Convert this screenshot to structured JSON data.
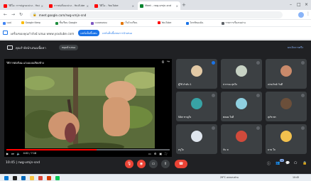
{
  "browser": {
    "tabs": [
      {
        "title": "วิดีโอ: การปลูกมะม่วง - YouTube",
        "favicon_color": "#ff0000"
      },
      {
        "title": "การต่อกิ่งมะม่วง - YouTube",
        "favicon_color": "#ff0000"
      },
      {
        "title": "วิดีโอ - YouTube",
        "favicon_color": "#ff0000"
      },
      {
        "title": "Meet - rwg-vmjn-snd",
        "favicon_color": "#00832d"
      }
    ],
    "url": "meet.google.com/rwg-vmjn-snd",
    "bookmarks": [
      {
        "label": "แอป",
        "color": "#4285f4"
      },
      {
        "label": "Google Keep",
        "color": "#fbbc04"
      },
      {
        "label": "ชั้นเรียน Google",
        "color": "#1e8e3e"
      },
      {
        "label": "แบบทดสอบ",
        "color": "#7e57c2"
      },
      {
        "label": "เว็บโรงเรียน",
        "color": "#e37400"
      },
      {
        "label": "YouTube",
        "color": "#ff0000"
      },
      {
        "label": "ไดรฟ์ของฉัน",
        "color": "#1a73e8"
      },
      {
        "label": "รายการเรื่องรออ่าน",
        "color": "#5f6368"
      }
    ]
  },
  "banner": {
    "text": "เครื่องของคุณกำลังนำเสนอ www.youtube.com",
    "share_button": "แชร์แท็บนี้แทน",
    "share_link": "แชร์แท็บนี้แทนการนำเสนอ"
  },
  "meet": {
    "presenting_text": "คุณกำลังนำเสนอเนื้อหา",
    "stop_button": "หยุดนำเสนอ",
    "right_link": "ยกเลิกการตรึง",
    "video": {
      "title": "วิธีการต่อกิ่งมะม่วงแบบเสียบข้าง",
      "current_time": "4:02 / 7:18",
      "progress": 0.55
    },
    "participants": [
      {
        "name": "ผู้ใช้ ลำดับ 1",
        "avatar_color": "#e2c9a5",
        "active": true
      },
      {
        "name": "ปวรรณ สุขใจ",
        "avatar_color": "#c7d2c4",
        "active": false
      },
      {
        "name": "เปรมวิทย์ วันดี",
        "avatar_color": "#c98a6b",
        "active": false
      },
      {
        "name": "นิธิศ ชาญใจ",
        "avatar_color": "#38a3a5",
        "active": false
      },
      {
        "name": "พลอย ใจดี",
        "avatar_color": "#8fd0e0",
        "active": false
      },
      {
        "name": "สุภัช พร",
        "avatar_color": "#6b4f3a",
        "active": false
      },
      {
        "name": "ครูใจ",
        "avatar_color": "#dfe6ee",
        "active": false
      },
      {
        "name": "กัน ท",
        "avatar_color": "#d14a3b",
        "active": false
      },
      {
        "name": "มาย ใจ",
        "avatar_color": "#f2c14e",
        "active": false
      }
    ],
    "clock": "10:45",
    "meeting_code": "rwg-vmjn-snd",
    "participant_count": "12"
  },
  "taskbar": {
    "weather": "29°C เมฆบางส่วน",
    "time": "10:45"
  }
}
